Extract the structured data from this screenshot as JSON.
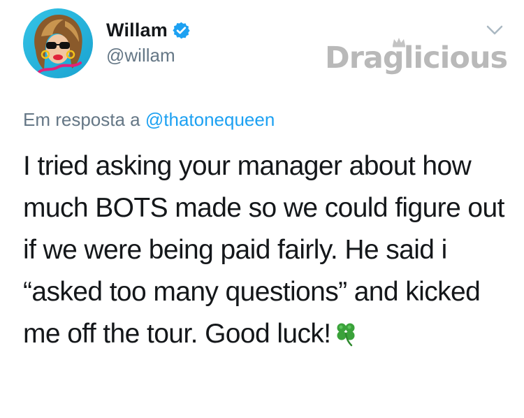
{
  "author": {
    "display_name": "Willam",
    "handle": "@willam",
    "verified": true,
    "avatar_icon": "profile-avatar-icon"
  },
  "watermark": {
    "text": "Draglicious",
    "color": "#b9b9b9"
  },
  "reply": {
    "prefix": "Em resposta a",
    "mention": "@thatonequeen"
  },
  "tweet": {
    "text": "I tried asking your manager about how much BOTS made so we could figure out if we were being paid fairly. He said i “asked too many questions” and kicked me off the tour. Good luck!",
    "emoji": "☘"
  },
  "colors": {
    "link": "#1da1f2",
    "secondary_text": "#657786",
    "primary_text": "#14171a"
  }
}
